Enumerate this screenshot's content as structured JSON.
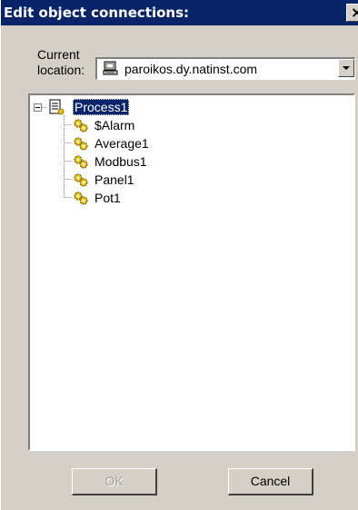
{
  "dialog": {
    "title": "Edit object connections:",
    "close_glyph": "✕"
  },
  "location": {
    "label_line1": "Current",
    "label_line2": "location:",
    "value": "paroikos.dy.natinst.com",
    "icon": "computer-icon"
  },
  "tree": {
    "root": {
      "label": "Process1",
      "icon": "process-document-icon",
      "expanded": true,
      "selected": true
    },
    "children": [
      {
        "label": "$Alarm",
        "icon": "gears-icon"
      },
      {
        "label": "Average1",
        "icon": "gears-icon"
      },
      {
        "label": "Modbus1",
        "icon": "gears-icon"
      },
      {
        "label": "Panel1",
        "icon": "gears-icon"
      },
      {
        "label": "Pot1",
        "icon": "gears-icon"
      }
    ]
  },
  "buttons": {
    "ok": "OK",
    "cancel": "Cancel"
  },
  "colors": {
    "titlebar": "#0a246a",
    "face": "#d4d0c8",
    "selection": "#0a246a",
    "gear": "#e8c000"
  }
}
